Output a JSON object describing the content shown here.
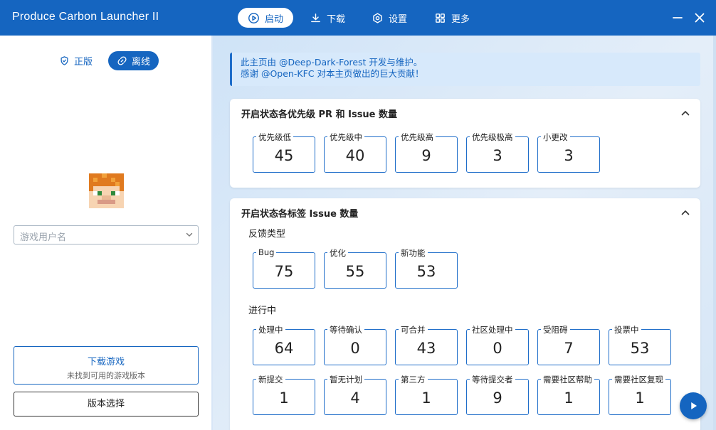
{
  "app": {
    "title": "Produce Carbon Launcher II"
  },
  "nav": {
    "launch": "启动",
    "download": "下载",
    "settings": "设置",
    "more": "更多"
  },
  "login": {
    "official": "正版",
    "offline": "离线",
    "username_placeholder": "游戏用户名",
    "download_game": "下载游戏",
    "no_version": "未找到可用的游戏版本",
    "version_select": "版本选择"
  },
  "notice": {
    "line1": "此主页由 @Deep-Dark-Forest 开发与维护。",
    "line2": "感谢 @Open-KFC 对本主页做出的巨大贡献！"
  },
  "priority_card": {
    "title": "开启状态各优先级 PR 和 Issue 数量",
    "stats": [
      {
        "label": "优先级低",
        "value": "45"
      },
      {
        "label": "优先级中",
        "value": "40"
      },
      {
        "label": "优先级高",
        "value": "9"
      },
      {
        "label": "优先级极高",
        "value": "3"
      },
      {
        "label": "小更改",
        "value": "3"
      }
    ]
  },
  "label_card": {
    "title": "开启状态各标签 Issue 数量",
    "feedback_heading": "反馈类型",
    "feedback": [
      {
        "label": "Bug",
        "value": "75"
      },
      {
        "label": "优化",
        "value": "55"
      },
      {
        "label": "新功能",
        "value": "53"
      }
    ],
    "progress_heading": "进行中",
    "progress_row1": [
      {
        "label": "处理中",
        "value": "64"
      },
      {
        "label": "等待确认",
        "value": "0"
      },
      {
        "label": "可合并",
        "value": "43"
      },
      {
        "label": "社区处理中",
        "value": "0"
      },
      {
        "label": "受阻碍",
        "value": "7"
      },
      {
        "label": "投票中",
        "value": "53"
      }
    ],
    "progress_row2": [
      {
        "label": "新提交",
        "value": "1"
      },
      {
        "label": "暂无计划",
        "value": "4"
      },
      {
        "label": "第三方",
        "value": "1"
      },
      {
        "label": "等待提交者",
        "value": "9"
      },
      {
        "label": "需要社区帮助",
        "value": "1"
      },
      {
        "label": "需要社区复现",
        "value": "1"
      }
    ]
  },
  "colors": {
    "accent": "#1565c0",
    "panel": "#ffffff"
  }
}
